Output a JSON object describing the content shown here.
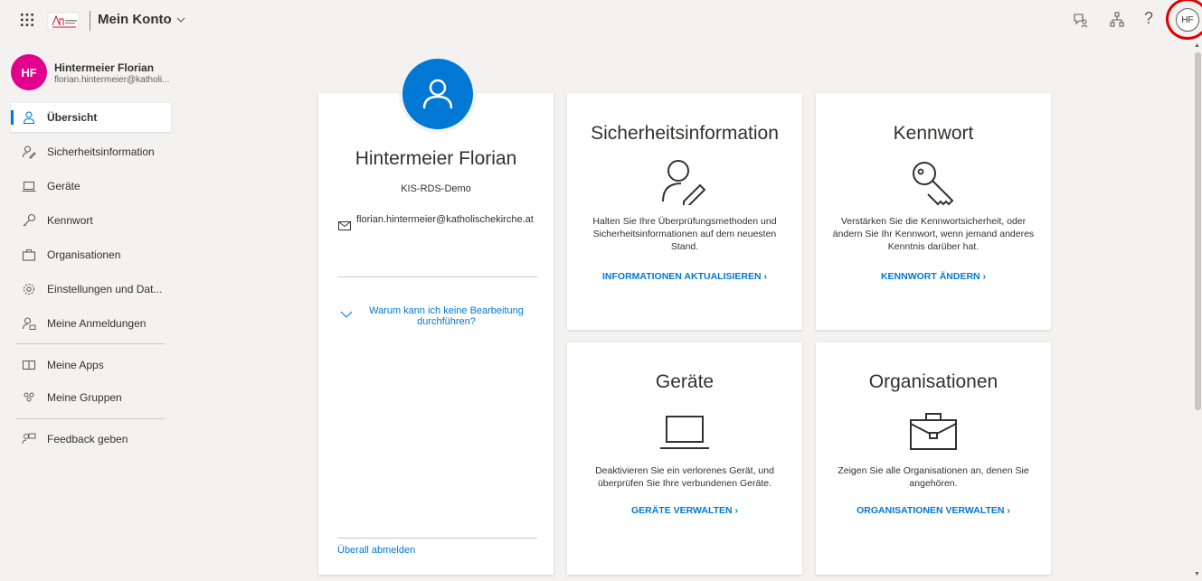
{
  "header": {
    "app_title": "Mein Konto",
    "avatar_initials": "HF",
    "help": "?"
  },
  "user": {
    "initials": "HF",
    "name": "Hintermeier Florian",
    "email_short": "florian.hintermeier@katholi..."
  },
  "sidebar": {
    "items": [
      {
        "label": "Übersicht",
        "icon": "person-icon",
        "active": true
      },
      {
        "label": "Sicherheitsinformation",
        "icon": "person-edit-icon"
      },
      {
        "label": "Geräte",
        "icon": "laptop-icon"
      },
      {
        "label": "Kennwort",
        "icon": "key-icon"
      },
      {
        "label": "Organisationen",
        "icon": "briefcase-icon"
      },
      {
        "label": "Einstellungen und Dat...",
        "icon": "gear-icon"
      },
      {
        "label": "Meine Anmeldungen",
        "icon": "person-lock-icon"
      },
      {
        "label": "Meine Apps",
        "icon": "apps-icon"
      },
      {
        "label": "Meine Gruppen",
        "icon": "groups-icon"
      },
      {
        "label": "Feedback geben",
        "icon": "feedback-icon"
      }
    ]
  },
  "profile": {
    "name": "Hintermeier Florian",
    "org": "KIS-RDS-Demo",
    "email": "florian.hintermeier@katholischekirche.at",
    "why_link": "Warum kann ich keine Bearbeitung durchführen?",
    "signout": "Überall abmelden"
  },
  "tiles": {
    "security": {
      "title": "Sicherheitsinformation",
      "desc": "Halten Sie Ihre Überprüfungsmethoden und Sicherheitsinformationen auf dem neuesten Stand.",
      "link": "INFORMATIONEN AKTUALISIEREN ›"
    },
    "password": {
      "title": "Kennwort",
      "desc": "Verstärken Sie die Kennwortsicherheit, oder ändern Sie Ihr Kennwort, wenn jemand anderes Kenntnis darüber hat.",
      "link": "KENNWORT ÄNDERN ›"
    },
    "devices": {
      "title": "Geräte",
      "desc": "Deaktivieren Sie ein verlorenes Gerät, und überprüfen Sie Ihre verbundenen Geräte.",
      "link": "GERÄTE VERWALTEN ›"
    },
    "orgs": {
      "title": "Organisationen",
      "desc": "Zeigen Sie alle Organisationen an, denen Sie angehören.",
      "link": "ORGANISATIONEN VERWALTEN ›"
    }
  },
  "colors": {
    "accent": "#0078d4",
    "avatar": "#e3008c",
    "highlight_circle": "#e00000"
  }
}
